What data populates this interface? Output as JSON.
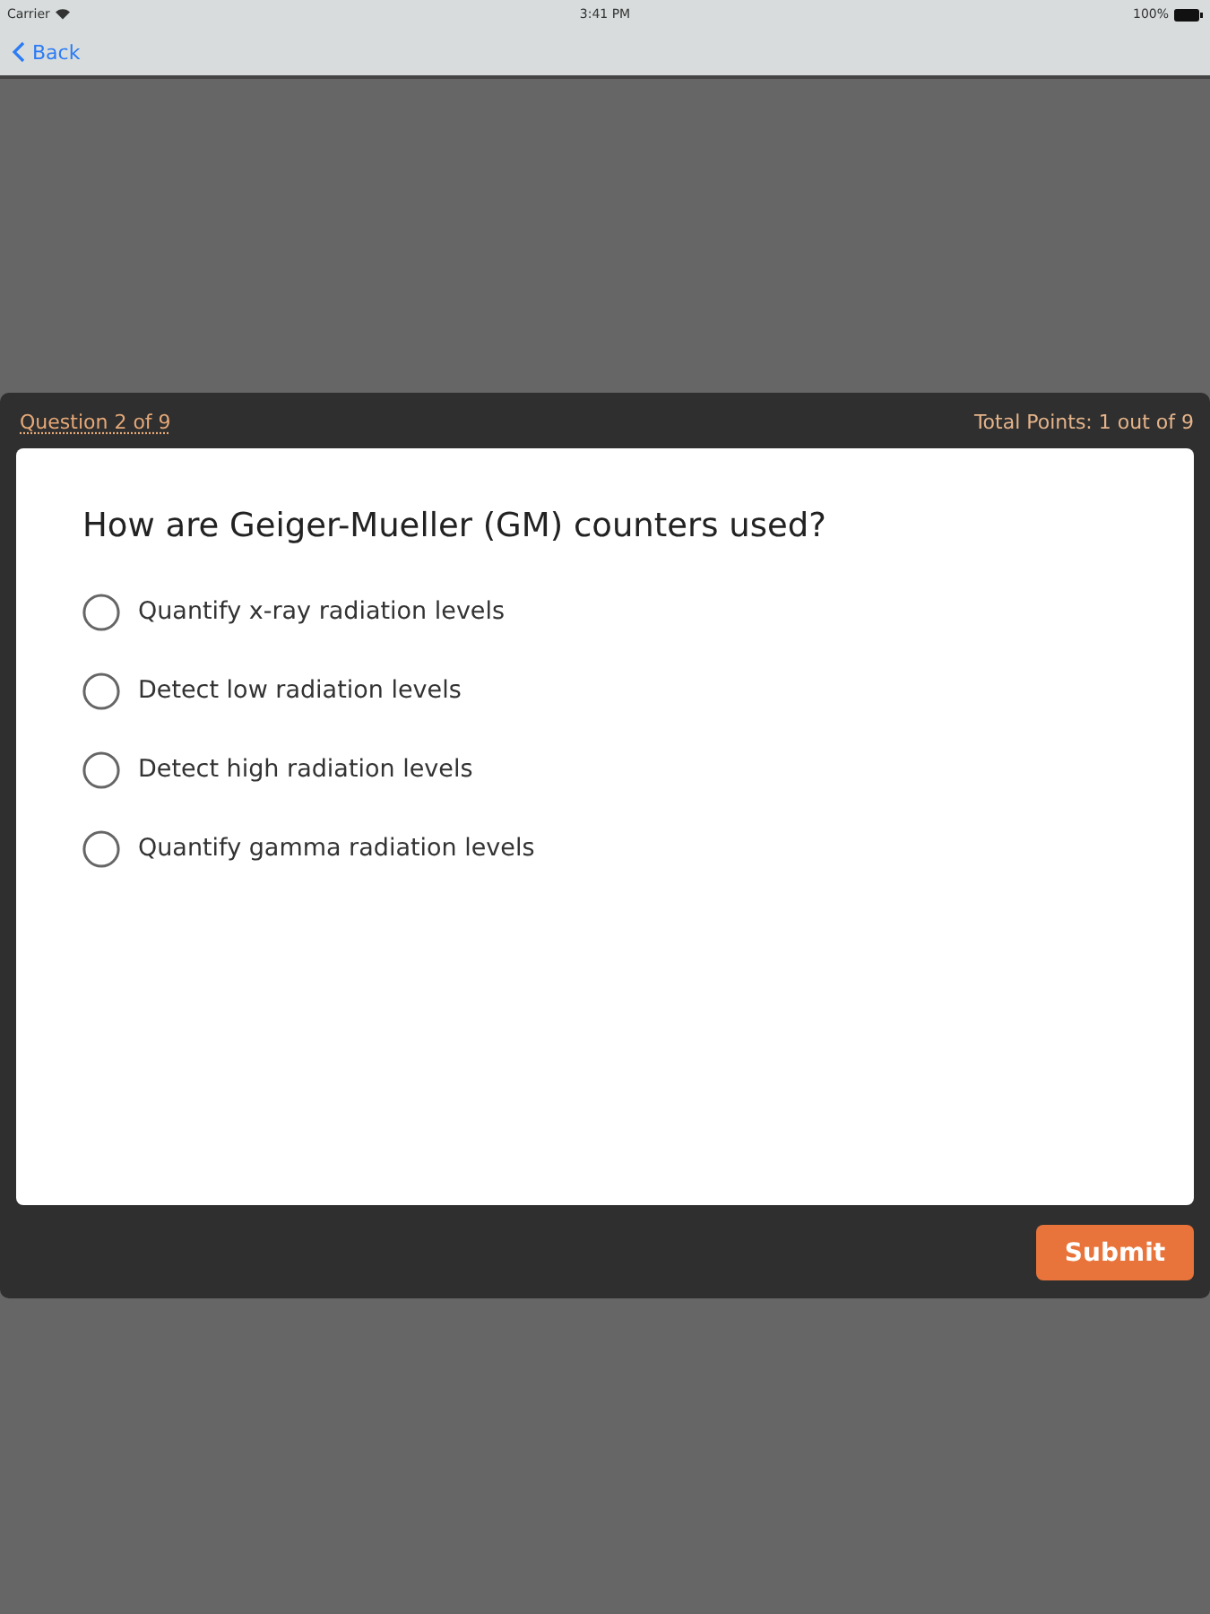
{
  "status_bar": {
    "carrier": "Carrier",
    "time": "3:41 PM",
    "battery": "100%"
  },
  "nav_bar": {
    "back": "Back"
  },
  "quiz": {
    "progress": "Question 2 of 9",
    "total_points": "Total Points: 1 out of 9",
    "question": "How are Geiger-Mueller (GM) counters used?",
    "options": [
      {
        "label": "Quantify x-ray radiation levels",
        "selected": false
      },
      {
        "label": "Detect low radiation levels",
        "selected": false
      },
      {
        "label": "Detect high radiation levels",
        "selected": false
      },
      {
        "label": "Quantify gamma radiation levels",
        "selected": false
      }
    ],
    "submit": "Submit"
  }
}
